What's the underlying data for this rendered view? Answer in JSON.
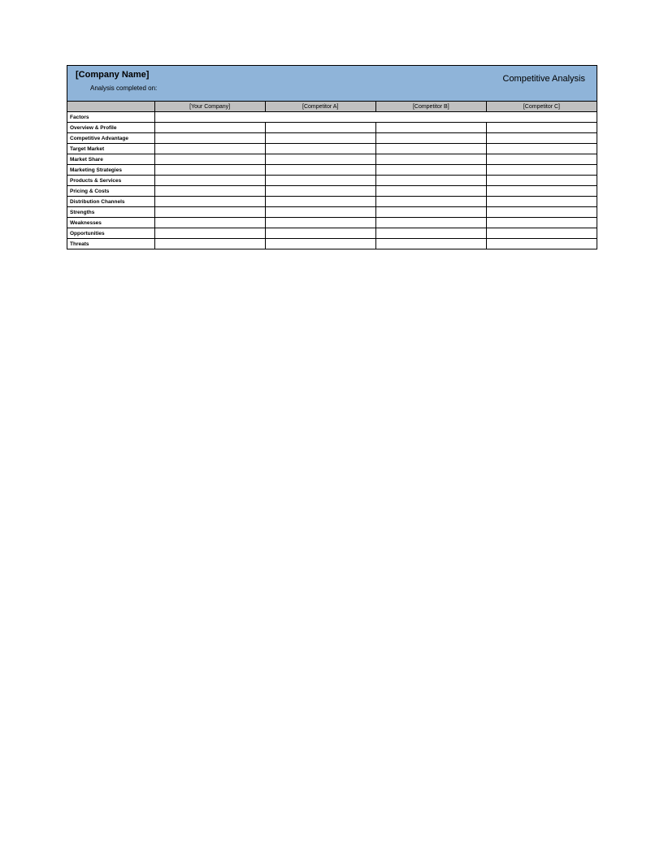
{
  "header": {
    "company_name": "[Company Name]",
    "analysis_date_label": "Analysis completed on:",
    "doc_title": "Competitive Analysis"
  },
  "table": {
    "columns": [
      "[Your Company]",
      "[Competitor A]",
      "[Competitor B]",
      "[Competitor C]"
    ],
    "factors_label": "Factors",
    "rows": [
      {
        "label": "Overview & Profile",
        "cells": [
          "",
          "",
          "",
          ""
        ]
      },
      {
        "label": "Competitive Advantage",
        "cells": [
          "",
          "",
          "",
          ""
        ]
      },
      {
        "label": "Target Market",
        "cells": [
          "",
          "",
          "",
          ""
        ]
      },
      {
        "label": "Market Share",
        "cells": [
          "",
          "",
          "",
          ""
        ]
      },
      {
        "label": "Marketing Strategies",
        "cells": [
          "",
          "",
          "",
          ""
        ]
      },
      {
        "label": "Products & Services",
        "cells": [
          "",
          "",
          "",
          ""
        ]
      },
      {
        "label": "Pricing & Costs",
        "cells": [
          "",
          "",
          "",
          ""
        ]
      },
      {
        "label": "Distribution Channels",
        "cells": [
          "",
          "",
          "",
          ""
        ]
      },
      {
        "label": "Strengths",
        "cells": [
          "",
          "",
          "",
          ""
        ]
      },
      {
        "label": "Weaknesses",
        "cells": [
          "",
          "",
          "",
          ""
        ]
      },
      {
        "label": "Opportunities",
        "cells": [
          "",
          "",
          "",
          ""
        ]
      },
      {
        "label": "Threats",
        "cells": [
          "",
          "",
          "",
          ""
        ]
      }
    ]
  }
}
